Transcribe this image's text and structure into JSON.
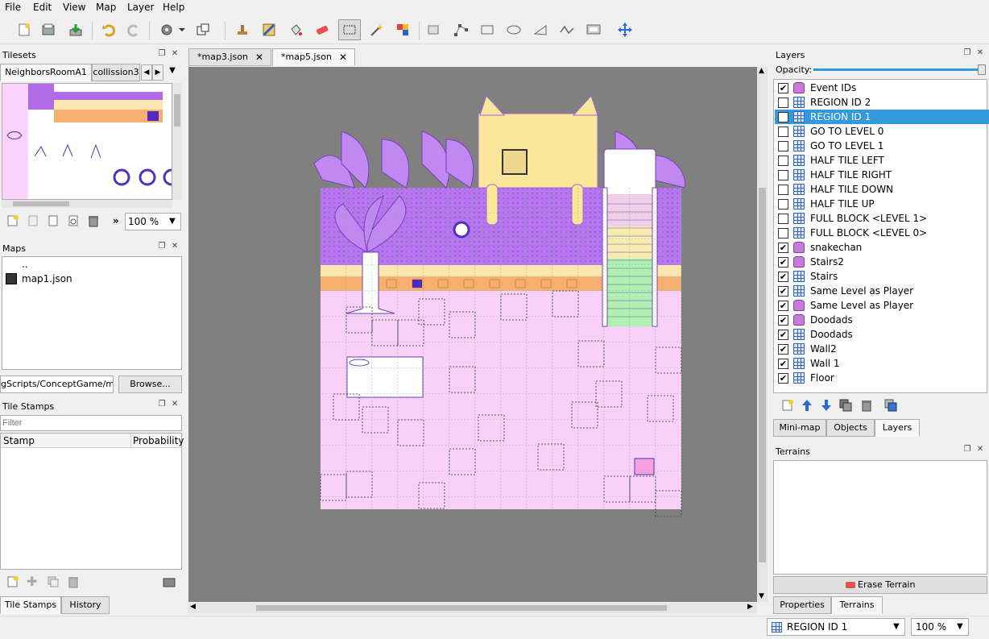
{
  "menu": [
    "File",
    "Edit",
    "View",
    "Map",
    "Layer",
    "Help"
  ],
  "toolbar": {
    "icons": [
      "new-file-icon",
      "open-file-icon",
      "save-icon",
      "undo-icon",
      "redo-icon",
      "commands-icon",
      "random-mode-icon",
      "stamp-brush-icon",
      "terrain-brush-icon",
      "bucket-fill-icon",
      "eraser-icon",
      "rectangular-select-icon",
      "magic-wand-icon",
      "select-same-tile-icon",
      "select-objects-icon",
      "edit-polygons-icon",
      "insert-rectangle-icon",
      "insert-ellipse-icon",
      "insert-polygon-icon",
      "insert-polyline-icon",
      "insert-tile-icon",
      "move-icon"
    ]
  },
  "tilesets": {
    "title": "Tilesets",
    "tabs": [
      "NeighborsRoomA1",
      "collission3"
    ],
    "zoom": "100 %"
  },
  "maps": {
    "title": "Maps",
    "items": [
      "..",
      "map1.json"
    ],
    "path": "gScripts/ConceptGame/maps",
    "browse": "Browse..."
  },
  "stamps": {
    "title": "Tile Stamps",
    "filter_placeholder": "Filter",
    "col_stamp": "Stamp",
    "col_probability": "Probability",
    "tabs": [
      "Tile Stamps",
      "History"
    ]
  },
  "editor": {
    "tabs": [
      "*map3.json",
      "*map5.json"
    ],
    "active_tab": 1
  },
  "layers": {
    "title": "Layers",
    "opacity_label": "Opacity:",
    "opacity": 1.0,
    "items": [
      {
        "name": "Event IDs",
        "type": "object",
        "checked": true
      },
      {
        "name": "REGION ID 2",
        "type": "tile",
        "checked": false
      },
      {
        "name": "REGION ID 1",
        "type": "tile",
        "checked": false,
        "selected": true
      },
      {
        "name": "GO TO LEVEL 0",
        "type": "tile",
        "checked": false
      },
      {
        "name": "GO TO LEVEL 1",
        "type": "tile",
        "checked": false
      },
      {
        "name": "HALF TILE LEFT",
        "type": "tile",
        "checked": false
      },
      {
        "name": "HALF TILE RIGHT",
        "type": "tile",
        "checked": false
      },
      {
        "name": "HALF TILE DOWN",
        "type": "tile",
        "checked": false
      },
      {
        "name": "HALF TILE UP",
        "type": "tile",
        "checked": false
      },
      {
        "name": "FULL BLOCK <LEVEL 1>",
        "type": "tile",
        "checked": false
      },
      {
        "name": "FULL BLOCK <LEVEL 0>",
        "type": "tile",
        "checked": false
      },
      {
        "name": "snakechan",
        "type": "object",
        "checked": true
      },
      {
        "name": "Stairs2",
        "type": "object",
        "checked": true
      },
      {
        "name": "Stairs",
        "type": "tile",
        "checked": true
      },
      {
        "name": "Same Level as Player",
        "type": "tile",
        "checked": true
      },
      {
        "name": "Same Level as Player",
        "type": "object",
        "checked": true
      },
      {
        "name": "Doodads",
        "type": "object",
        "checked": true
      },
      {
        "name": "Doodads",
        "type": "tile",
        "checked": true
      },
      {
        "name": "Wall2",
        "type": "tile",
        "checked": true
      },
      {
        "name": "Wall 1",
        "type": "tile",
        "checked": true
      },
      {
        "name": "Floor",
        "type": "tile",
        "checked": true
      }
    ],
    "bottom_tabs": [
      "Mini-map",
      "Objects",
      "Layers"
    ]
  },
  "terrains": {
    "title": "Terrains",
    "erase": "Erase Terrain",
    "tabs": [
      "Properties",
      "Terrains"
    ]
  },
  "status": {
    "layer": "REGION ID 1",
    "zoom": "100 %"
  },
  "colors": {
    "selection": "#3399dd",
    "canvas_bg": "#808080",
    "floor": "#f8d0f8",
    "wall": "#b06ae8"
  }
}
